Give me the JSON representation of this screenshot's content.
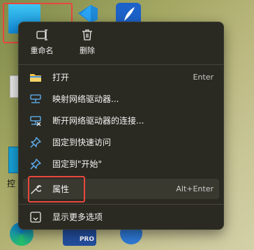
{
  "context_menu": {
    "quick_actions": [
      {
        "label": "重命名",
        "icon": "rename-icon"
      },
      {
        "label": "删除",
        "icon": "trash-icon"
      }
    ],
    "items": [
      {
        "label": "打开",
        "shortcut": "Enter",
        "icon": "folder-icon"
      },
      {
        "label": "映射网络驱动器...",
        "shortcut": "",
        "icon": "network-drive-icon"
      },
      {
        "label": "断开网络驱动器的连接...",
        "shortcut": "",
        "icon": "disconnect-drive-icon"
      },
      {
        "label": "固定到快速访问",
        "shortcut": "",
        "icon": "pin-icon"
      },
      {
        "label": "固定到\"开始\"",
        "shortcut": "",
        "icon": "pin-icon"
      },
      {
        "label": "属性",
        "shortcut": "Alt+Enter",
        "icon": "wrench-icon"
      }
    ],
    "footer": {
      "label": "显示更多选项",
      "icon": "more-options-icon"
    }
  },
  "desktop": {
    "partial_labels": [
      "控"
    ],
    "badge_text": "PRO"
  },
  "colors": {
    "menu_bg": "#2b2a22",
    "highlight": "#e8473e",
    "pin_blue": "#5fb7ff",
    "folder_yellow": "#f4c542"
  }
}
